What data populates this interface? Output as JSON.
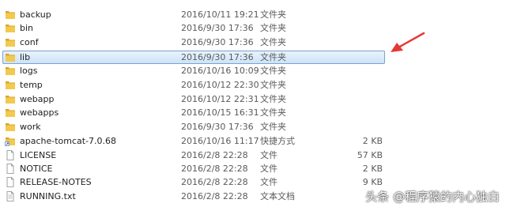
{
  "files": [
    {
      "name": "backup",
      "date": "2016/10/11 19:21",
      "type": "文件夹",
      "size": "",
      "icon": "folder-icon"
    },
    {
      "name": "bin",
      "date": "2016/9/30 17:36",
      "type": "文件夹",
      "size": "",
      "icon": "folder-icon"
    },
    {
      "name": "conf",
      "date": "2016/9/30 17:36",
      "type": "文件夹",
      "size": "",
      "icon": "folder-icon"
    },
    {
      "name": "lib",
      "date": "2016/9/30 17:36",
      "type": "文件夹",
      "size": "",
      "icon": "folder-icon",
      "selected": true
    },
    {
      "name": "logs",
      "date": "2016/10/16 10:09",
      "type": "文件夹",
      "size": "",
      "icon": "folder-icon"
    },
    {
      "name": "temp",
      "date": "2016/10/12 22:30",
      "type": "文件夹",
      "size": "",
      "icon": "folder-icon"
    },
    {
      "name": "webapp",
      "date": "2016/10/12 22:31",
      "type": "文件夹",
      "size": "",
      "icon": "folder-icon"
    },
    {
      "name": "webapps",
      "date": "2016/10/15 16:31",
      "type": "文件夹",
      "size": "",
      "icon": "folder-icon"
    },
    {
      "name": "work",
      "date": "2016/9/30 17:36",
      "type": "文件夹",
      "size": "",
      "icon": "folder-icon"
    },
    {
      "name": "apache-tomcat-7.0.68",
      "date": "2016/10/16 11:17",
      "type": "快捷方式",
      "size": "2 KB",
      "icon": "shortcut-icon"
    },
    {
      "name": "LICENSE",
      "date": "2016/2/8 22:28",
      "type": "文件",
      "size": "57 KB",
      "icon": "file-icon"
    },
    {
      "name": "NOTICE",
      "date": "2016/2/8 22:28",
      "type": "文件",
      "size": "2 KB",
      "icon": "file-icon"
    },
    {
      "name": "RELEASE-NOTES",
      "date": "2016/2/8 22:28",
      "type": "文件",
      "size": "9 KB",
      "icon": "file-icon"
    },
    {
      "name": "RUNNING.txt",
      "date": "2016/2/8 22:28",
      "type": "文本文档",
      "size": "",
      "icon": "text-file-icon"
    }
  ],
  "colors": {
    "folder": "#f3c94f",
    "folder_dark": "#d9a72a",
    "selection_border": "#7da2ce",
    "arrow": "#e53935"
  },
  "watermark": "头条 @程序猿的内心独白"
}
